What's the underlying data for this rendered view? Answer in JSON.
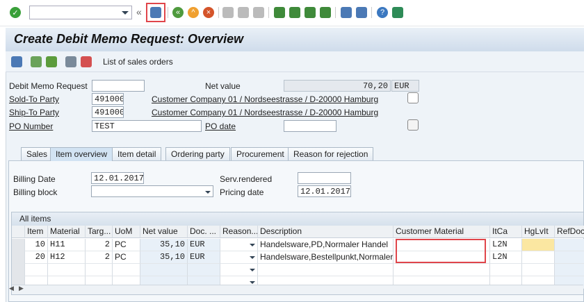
{
  "toolbar": {
    "command_field": "",
    "icons": [
      "enter-icon",
      "save-icon",
      "back-icon",
      "exit-icon",
      "cancel-icon",
      "print-icon",
      "find-icon",
      "find-next-icon",
      "first-page-icon",
      "prev-page-icon",
      "next-page-icon",
      "last-page-icon",
      "new-session-icon",
      "shortcut-icon",
      "help-icon",
      "customize-icon"
    ]
  },
  "title": "Create Debit Memo Request: Overview",
  "app_toolbar": {
    "list_label": "List of sales orders"
  },
  "header": {
    "debit_memo_label": "Debit Memo Request",
    "debit_memo_value": "",
    "net_value_label": "Net value",
    "net_value": "70,20",
    "currency": "EUR",
    "sold_to_label": "Sold-To Party",
    "sold_to_value": "491000",
    "sold_to_desc": "Customer Company 01 / Nordseestrasse / D-20000 Hamburg",
    "ship_to_label": "Ship-To Party",
    "ship_to_value": "491000",
    "ship_to_desc": "Customer Company 01 / Nordseestrasse / D-20000 Hamburg",
    "po_number_label": "PO Number",
    "po_number_value": "TEST",
    "po_date_label": "PO date",
    "po_date_value": ""
  },
  "tabs": [
    "Sales",
    "Item overview",
    "Item detail",
    "Ordering party",
    "Procurement",
    "Reason for rejection"
  ],
  "active_tab": "Item overview",
  "tab_content": {
    "billing_date_label": "Billing Date",
    "billing_date": "12.01.2017",
    "billing_block_label": "Billing block",
    "billing_block": "",
    "serv_rendered_label": "Serv.rendered",
    "serv_rendered": "",
    "pricing_date_label": "Pricing date",
    "pricing_date": "12.01.2017"
  },
  "table": {
    "title": "All items",
    "columns": [
      "Item",
      "Material",
      "Targ...",
      "UoM",
      "Net value",
      "Doc. ...",
      "Reason...",
      "Description",
      "Customer Material",
      "ItCa",
      "HgLvIt",
      "RefDoc"
    ],
    "rows": [
      [
        "10",
        "H11",
        "2",
        "PC",
        "35,10",
        "EUR",
        "",
        "Handelsware,PD,Normaler Handel",
        "",
        "L2N",
        "",
        ""
      ],
      [
        "20",
        "H12",
        "2",
        "PC",
        "35,10",
        "EUR",
        "",
        "Handelsware,Bestellpunkt,Normaler H...",
        "",
        "L2N",
        "",
        ""
      ],
      [
        "",
        "",
        "",
        "",
        "",
        "",
        "",
        "",
        "",
        "",
        "",
        ""
      ],
      [
        "",
        "",
        "",
        "",
        "",
        "",
        "",
        "",
        "",
        "",
        "",
        ""
      ]
    ]
  }
}
